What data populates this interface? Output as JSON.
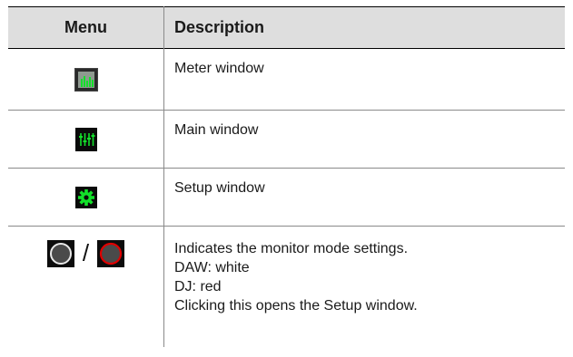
{
  "table": {
    "headers": {
      "menu": "Menu",
      "description": "Description"
    },
    "rows": [
      {
        "icon": "meter-window-icon",
        "lines": [
          "Meter window"
        ]
      },
      {
        "icon": "mixer-faders-icon",
        "lines": [
          "Main window"
        ]
      },
      {
        "icon": "gear-icon",
        "lines": [
          "Setup window"
        ]
      },
      {
        "icon": "monitor-mode-icons",
        "separator": "/",
        "lines": [
          "Indicates the monitor mode settings.",
          "DAW: white",
          "DJ: red",
          "Clicking this opens the Setup window."
        ]
      }
    ]
  },
  "colors": {
    "header_bg": "#dedede",
    "icon_green": "#13e02a",
    "monitor_white": "#e8e8e8",
    "monitor_red": "#e00000"
  }
}
